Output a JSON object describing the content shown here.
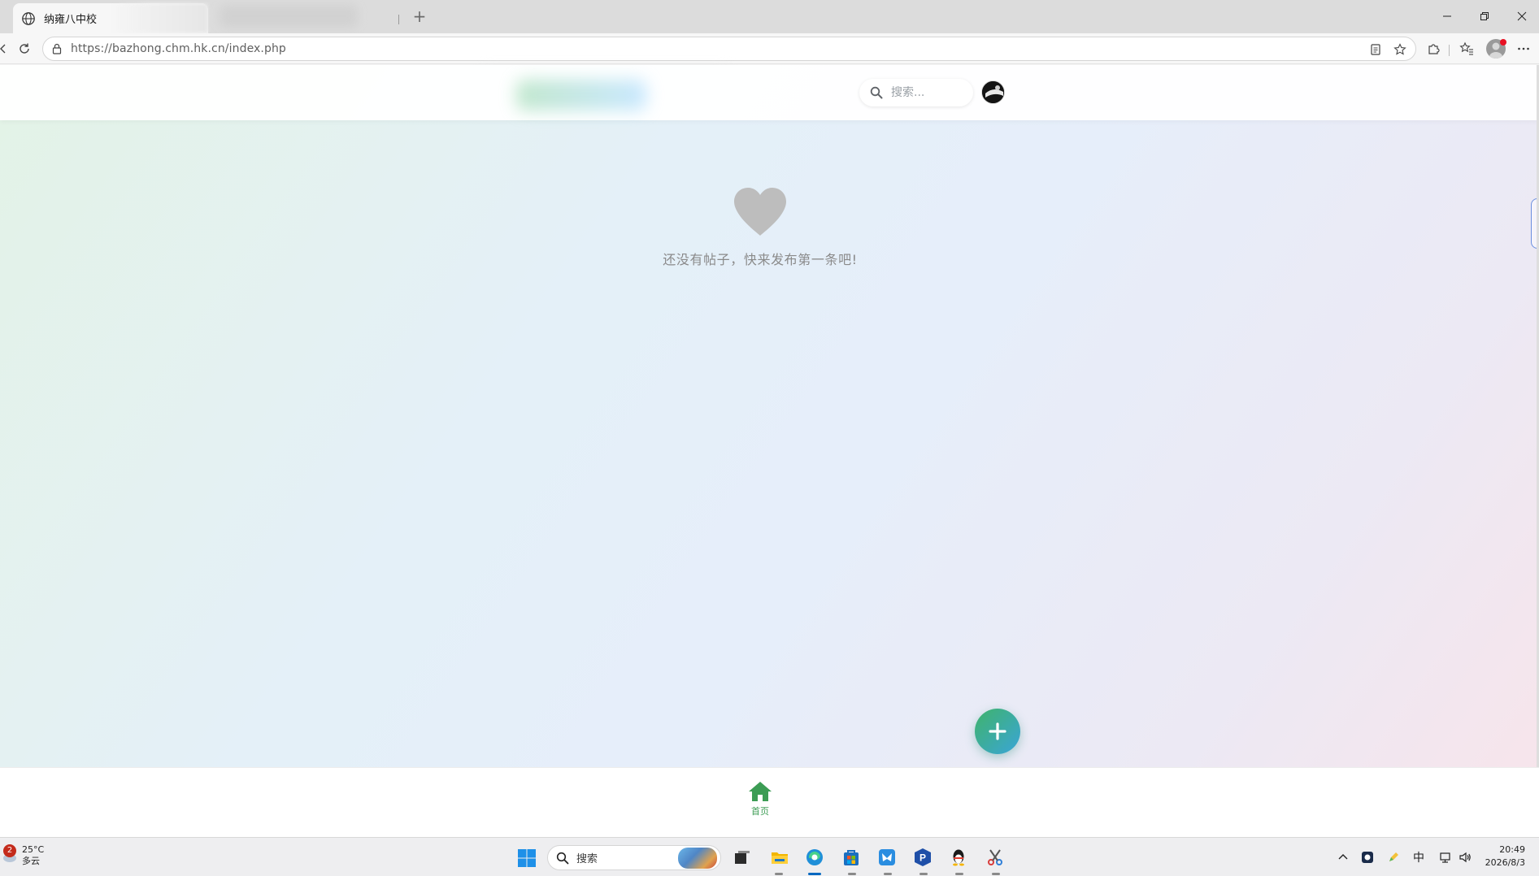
{
  "browser": {
    "tab": {
      "title": "纳雍八中校"
    },
    "address_bar": {
      "url": "https://bazhong.chm.hk.cn/index.php"
    }
  },
  "site": {
    "header": {
      "search": {
        "placeholder": "搜索..."
      }
    },
    "empty_state": {
      "message": "还没有帖子，快来发布第一条吧!"
    },
    "bottom_nav": {
      "items": [
        {
          "label": "首页",
          "active": true
        }
      ]
    },
    "colors": {
      "accent_green": "#3fb36a",
      "accent_blue": "#3aa5d8",
      "heart_gray": "#bdbdbd",
      "empty_text": "#8a8a8a"
    }
  },
  "taskbar": {
    "weather": {
      "badge": "2",
      "temperature": "25°C",
      "condition": "多云"
    },
    "search_label": "搜索",
    "tray": {
      "ime": "中"
    },
    "clock": {
      "time": "20:49",
      "date": "2026/8/3"
    }
  }
}
